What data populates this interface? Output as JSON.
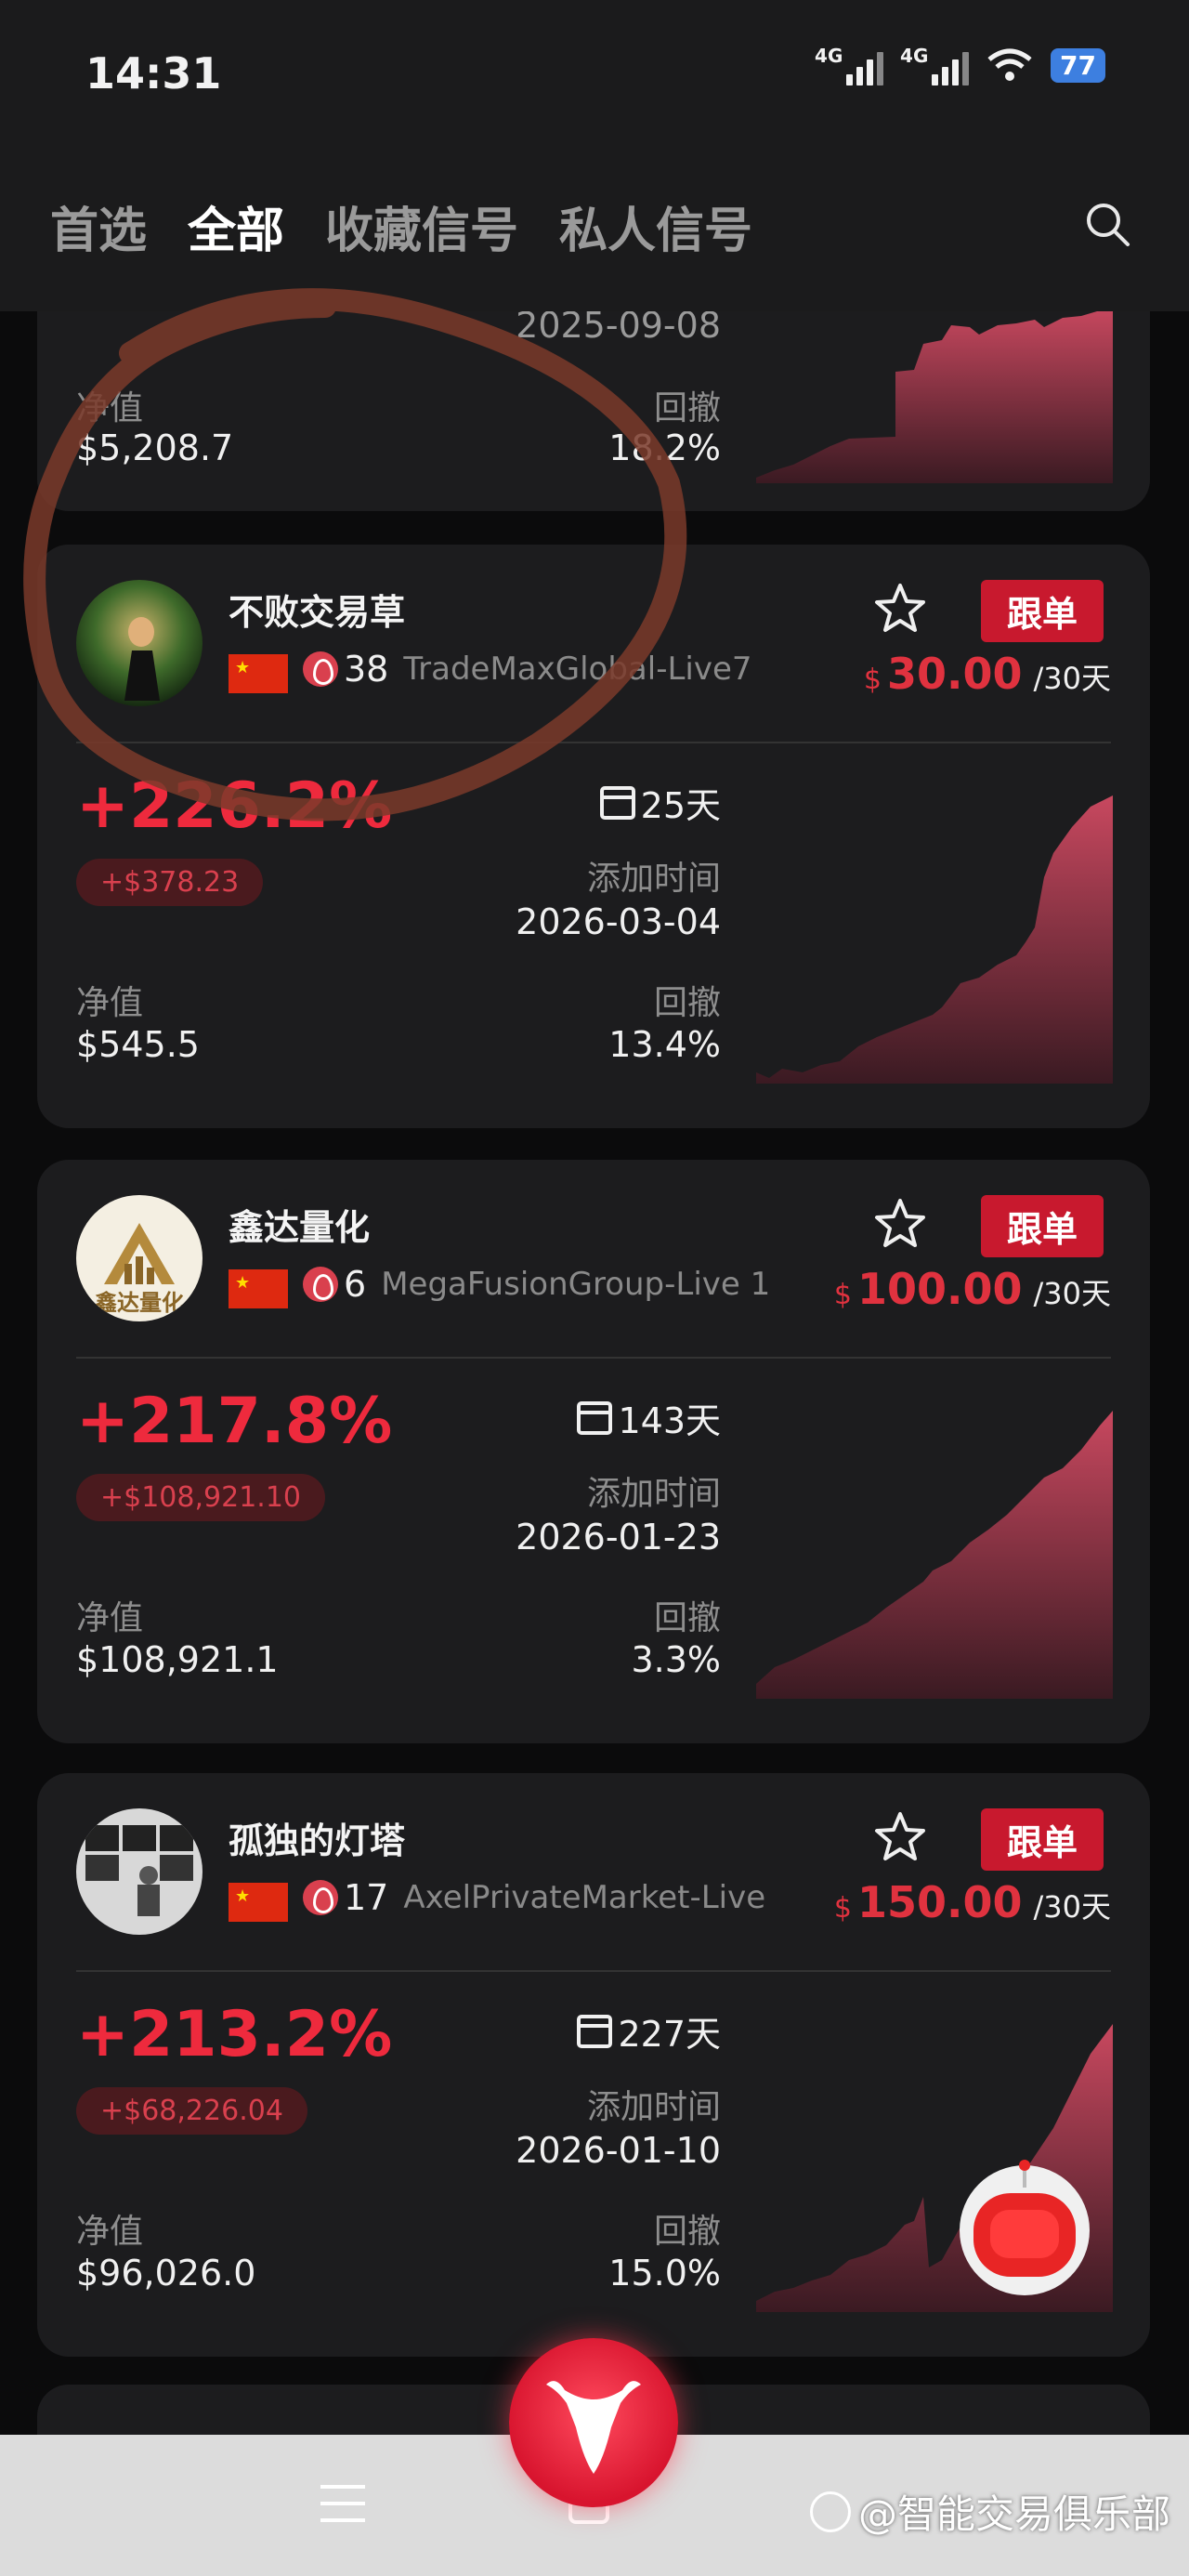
{
  "status": {
    "time": "14:31",
    "net1": "4G",
    "net2": "4G",
    "battery": "77"
  },
  "tabs": [
    {
      "label": "首选"
    },
    {
      "label": "全部"
    },
    {
      "label": "收藏信号"
    },
    {
      "label": "私人信号"
    }
  ],
  "partial_card": {
    "add_date": "2025-09-08",
    "nav_label": "净值",
    "nav_value": "$5,208.7",
    "dd_label": "回撤",
    "dd_value": "18.2%"
  },
  "cards": [
    {
      "name": "不败交易草",
      "heat": "38",
      "account": "TradeMaxGlobal-Live7",
      "follow_label": "跟单",
      "currency": "$",
      "price": "30.00",
      "period": "/30天",
      "return": "+226.2%",
      "profit": "+$378.23",
      "days": "25天",
      "add_label": "添加时间",
      "add_date": "2026-03-04",
      "nav_label": "净值",
      "nav_value": "$545.5",
      "dd_label": "回撤",
      "dd_value": "13.4%"
    },
    {
      "name": "鑫达量化",
      "heat": "6",
      "account": "MegaFusionGroup-Live 1",
      "follow_label": "跟单",
      "currency": "$",
      "price": "100.00",
      "period": "/30天",
      "return": "+217.8%",
      "profit": "+$108,921.10",
      "days": "143天",
      "add_label": "添加时间",
      "add_date": "2026-01-23",
      "nav_label": "净值",
      "nav_value": "$108,921.1",
      "dd_label": "回撤",
      "dd_value": "3.3%",
      "avatar_text": "鑫达量化"
    },
    {
      "name": "孤独的灯塔",
      "heat": "17",
      "account": "AxelPrivateMarket-Live",
      "follow_label": "跟单",
      "currency": "$",
      "price": "150.00",
      "period": "/30天",
      "return": "+213.2%",
      "profit": "+$68,226.04",
      "days": "227天",
      "add_label": "添加时间",
      "add_date": "2026-01-10",
      "nav_label": "净值",
      "nav_value": "$96,026.0",
      "dd_label": "回撤",
      "dd_value": "15.0%"
    }
  ],
  "watermark": "@智能交易俱乐部",
  "colors": {
    "accent": "#e0323f",
    "card": "#1c1c1e",
    "follow_btn": "#c8192e",
    "annotation": "#7a3a2a"
  }
}
